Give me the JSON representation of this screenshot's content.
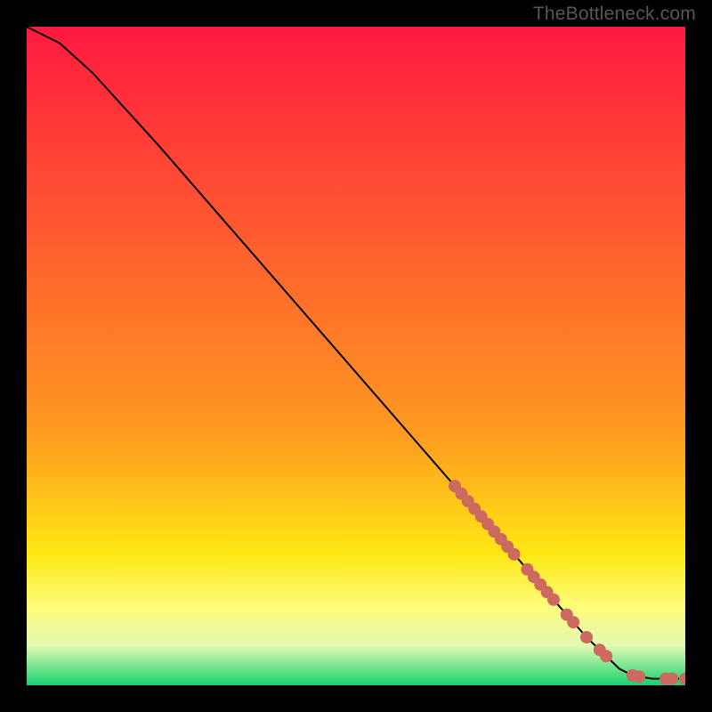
{
  "watermark": "TheBottleneck.com",
  "chart_data": {
    "type": "line",
    "title": "",
    "xlabel": "",
    "ylabel": "",
    "xlim": [
      0,
      100
    ],
    "ylim": [
      0,
      100
    ],
    "series": [
      {
        "name": "bottleneck-curve",
        "x": [
          0,
          2,
          5,
          10,
          20,
          30,
          40,
          50,
          60,
          70,
          80,
          85,
          90,
          92,
          95,
          98,
          100
        ],
        "y": [
          100,
          99,
          97.5,
          93,
          82,
          70.5,
          59,
          47.5,
          36,
          24.5,
          13,
          7.3,
          2.5,
          1.5,
          1,
          1,
          1
        ]
      }
    ],
    "markers": {
      "name": "highlight-segment",
      "x": [
        65,
        66,
        67,
        68,
        69,
        70,
        71,
        72,
        73,
        74,
        76,
        77,
        78,
        79,
        80,
        82,
        83,
        85,
        87,
        88,
        92,
        93,
        97,
        98,
        100
      ],
      "y": [
        30.25,
        29.1,
        27.95,
        26.8,
        25.65,
        24.5,
        23.35,
        22.2,
        21.05,
        19.9,
        17.6,
        16.45,
        15.3,
        14.15,
        13,
        10.72,
        9.58,
        7.3,
        5.38,
        4.42,
        1.5,
        1.3,
        1,
        1,
        1
      ]
    },
    "background_gradient_top": "#ff193f",
    "background_gradient_0_62": "#fe9b20",
    "background_gradient_0_80": "#ffe714",
    "background_gradient_0_88": "#fffc78",
    "background_gradient_0_94": "#e2f9b4",
    "background_gradient_bottom": "#16d36f",
    "marker_color": "#cc6a5f",
    "line_color": "#000000"
  }
}
